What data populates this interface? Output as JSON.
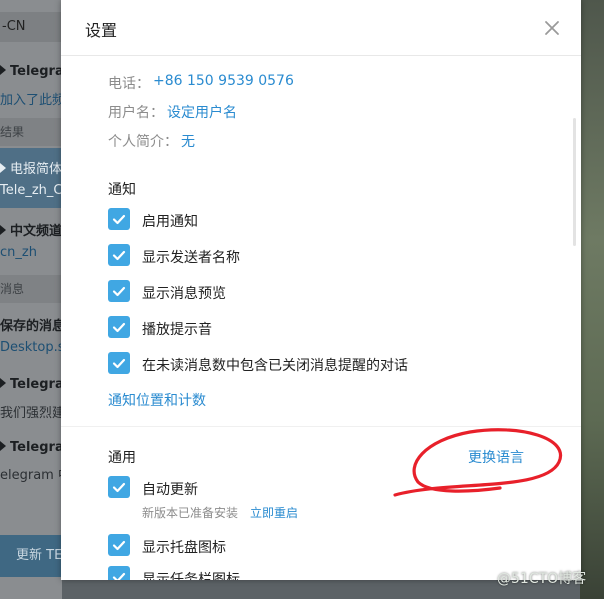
{
  "background": {
    "header": "-CN",
    "chats": [
      {
        "title": "Telegram",
        "snippet": "加入了此频"
      },
      {
        "section": "结果"
      },
      {
        "title": "电报简体",
        "snippet": "Tele_zh_CN"
      },
      {
        "title": "中文频道",
        "snippet": "cn_zh"
      },
      {
        "section": "消息"
      },
      {
        "title": "保存的消息",
        "snippet": "Desktop.st"
      },
      {
        "title": "Telegram",
        "snippet": "我们强烈建议"
      },
      {
        "title": "Telegram",
        "snippet": "elegram 中"
      }
    ],
    "bottom_button": "更新 TE"
  },
  "dialog": {
    "title": "设置",
    "close_icon": "close-icon",
    "profile": {
      "phone_label": "电话：",
      "phone_value": "+86 150 9539 0576",
      "username_label": "用户名：",
      "username_value": "设定用户名",
      "bio_label": "个人简介：",
      "bio_value": "无"
    },
    "notifications": {
      "heading": "通知",
      "items": [
        {
          "label": "启用通知",
          "checked": true
        },
        {
          "label": "显示发送者名称",
          "checked": true
        },
        {
          "label": "显示消息预览",
          "checked": true
        },
        {
          "label": "播放提示音",
          "checked": true
        },
        {
          "label": "在未读消息数中包含已关闭消息提醒的对话",
          "checked": true
        }
      ],
      "link": "通知位置和计数"
    },
    "general": {
      "heading": "通用",
      "change_language": "更换语言",
      "items": [
        {
          "label": "自动更新",
          "checked": true
        },
        {
          "label": "显示托盘图标",
          "checked": true
        },
        {
          "label": "显示任务栏图标",
          "checked": true
        }
      ],
      "update_status": "新版本已准备安装",
      "restart_now": "立即重启"
    }
  },
  "watermark": "@51CTO博客",
  "colors": {
    "accent": "#40a7e3",
    "link": "#2a8bd0",
    "annotation": "#e8202a"
  }
}
